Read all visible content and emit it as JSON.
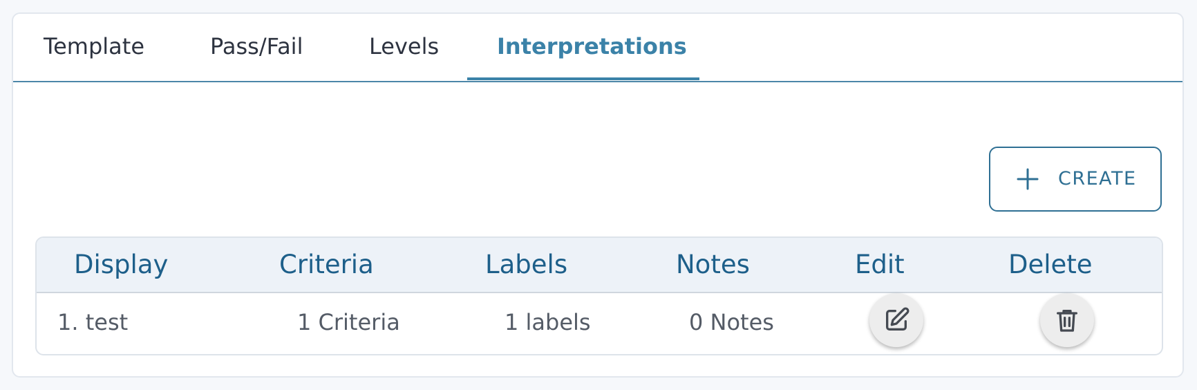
{
  "tabs": [
    {
      "label": "Template"
    },
    {
      "label": "Pass/Fail"
    },
    {
      "label": "Levels"
    },
    {
      "label": "Interpretations"
    }
  ],
  "active_tab": "Interpretations",
  "create_button": {
    "label": "CREATE",
    "icon": "plus-icon"
  },
  "table": {
    "headers": [
      "Display",
      "Criteria",
      "Labels",
      "Notes",
      "Edit",
      "Delete"
    ],
    "rows": [
      {
        "display": "1. test",
        "criteria": "1 Criteria",
        "labels": "1 labels",
        "notes": "0 Notes",
        "edit_icon": "pencil-square-icon",
        "delete_icon": "trash-icon"
      }
    ]
  },
  "colors": {
    "accent": "#3b82a8",
    "header_text": "#1d5f8a",
    "header_bg": "#edf2f8",
    "body_text": "#545b66"
  }
}
